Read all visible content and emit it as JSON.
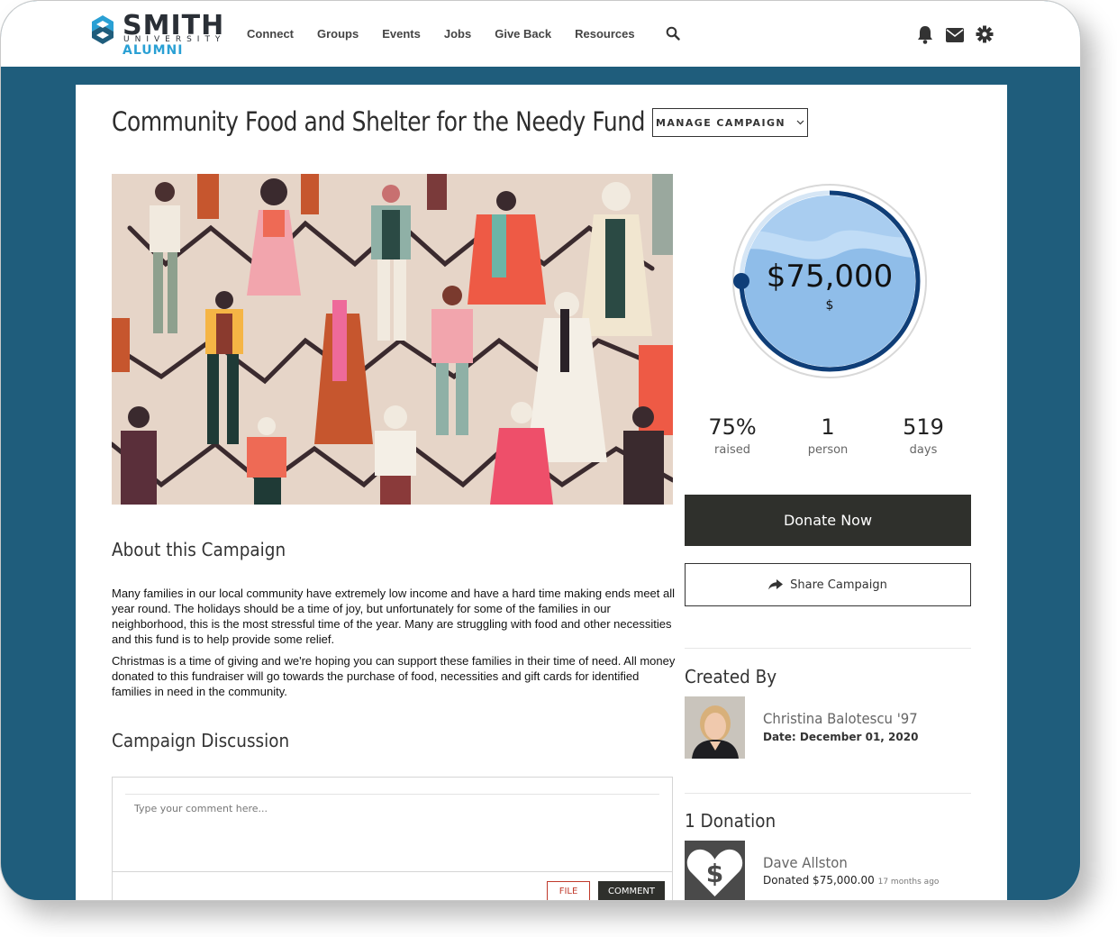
{
  "brand": {
    "name_line1": "SMITH",
    "name_line2": "UNIVERSITY",
    "name_line3": "ALUMNI",
    "accent_color": "#2aa0d4",
    "background_color": "#1f5d7c"
  },
  "nav": {
    "items": [
      "Connect",
      "Groups",
      "Events",
      "Jobs",
      "Give Back",
      "Resources"
    ],
    "icons": [
      "search-icon",
      "bell-icon",
      "mail-icon",
      "gear-icon"
    ]
  },
  "campaign": {
    "title": "Community Food and Shelter for the Needy Fund",
    "manage_label": "MANAGE CAMPAIGN",
    "goal_amount": "$75,000",
    "goal_unit": "$",
    "progress_fraction": 0.75,
    "stats": [
      {
        "value": "75%",
        "label": "raised"
      },
      {
        "value": "1",
        "label": "person"
      },
      {
        "value": "519",
        "label": "days"
      }
    ],
    "donate_label": "Donate Now",
    "share_label": "Share Campaign"
  },
  "about": {
    "heading": "About this Campaign",
    "paragraphs": [
      "Many families in our local community have extremely low income and have a hard time making ends meet all year round. The holidays should be a time of joy, but unfortunately for some of the families in our neighborhood, this is the most stressful time of the year. Many are struggling with food and other necessities and this fund is to help provide some relief.",
      "Christmas is a time of giving and we're hoping you can support these families in their time of need. All money donated to this fundraiser will go towards the purchase of food, necessities and gift cards for identified families in need in the community."
    ]
  },
  "discussion": {
    "heading": "Campaign Discussion",
    "placeholder": "Type your comment here...",
    "file_label": "FILE",
    "comment_label": "COMMENT"
  },
  "creator": {
    "heading": "Created By",
    "name": "Christina Balotescu '97",
    "date": "Date: December 01, 2020"
  },
  "donations": {
    "heading": "1 Donation",
    "donor_name": "Dave Allston",
    "donated_text": "Donated $75,000.00",
    "ago": "17 months ago"
  }
}
